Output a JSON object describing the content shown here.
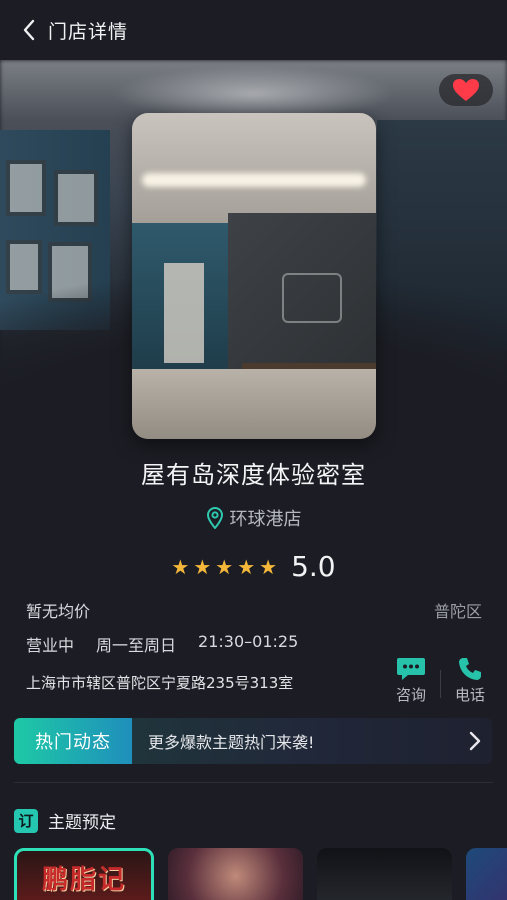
{
  "header": {
    "title": "门店详情"
  },
  "store": {
    "name": "屋有岛深度体验密室",
    "branch": "环球港店",
    "rating": {
      "score": "5.0",
      "stars": 5
    },
    "price": "暂无均价",
    "district": "普陀区",
    "status": "营业中",
    "days": "周一至周日",
    "time": "21:30–01:25",
    "address": "上海市市辖区普陀区宁夏路235号313室"
  },
  "actions": {
    "consult": "咨询",
    "phone": "电话"
  },
  "news": {
    "tag": "热门动态",
    "text": "更多爆款主题热门来袭!"
  },
  "section": {
    "badge": "订",
    "title": "主题预定"
  },
  "themes": [
    {
      "title": "鹏脂记"
    }
  ],
  "colors": {
    "accent": "#25c7b0",
    "heart": "#ff3b4a",
    "star": "#f4b73a"
  }
}
